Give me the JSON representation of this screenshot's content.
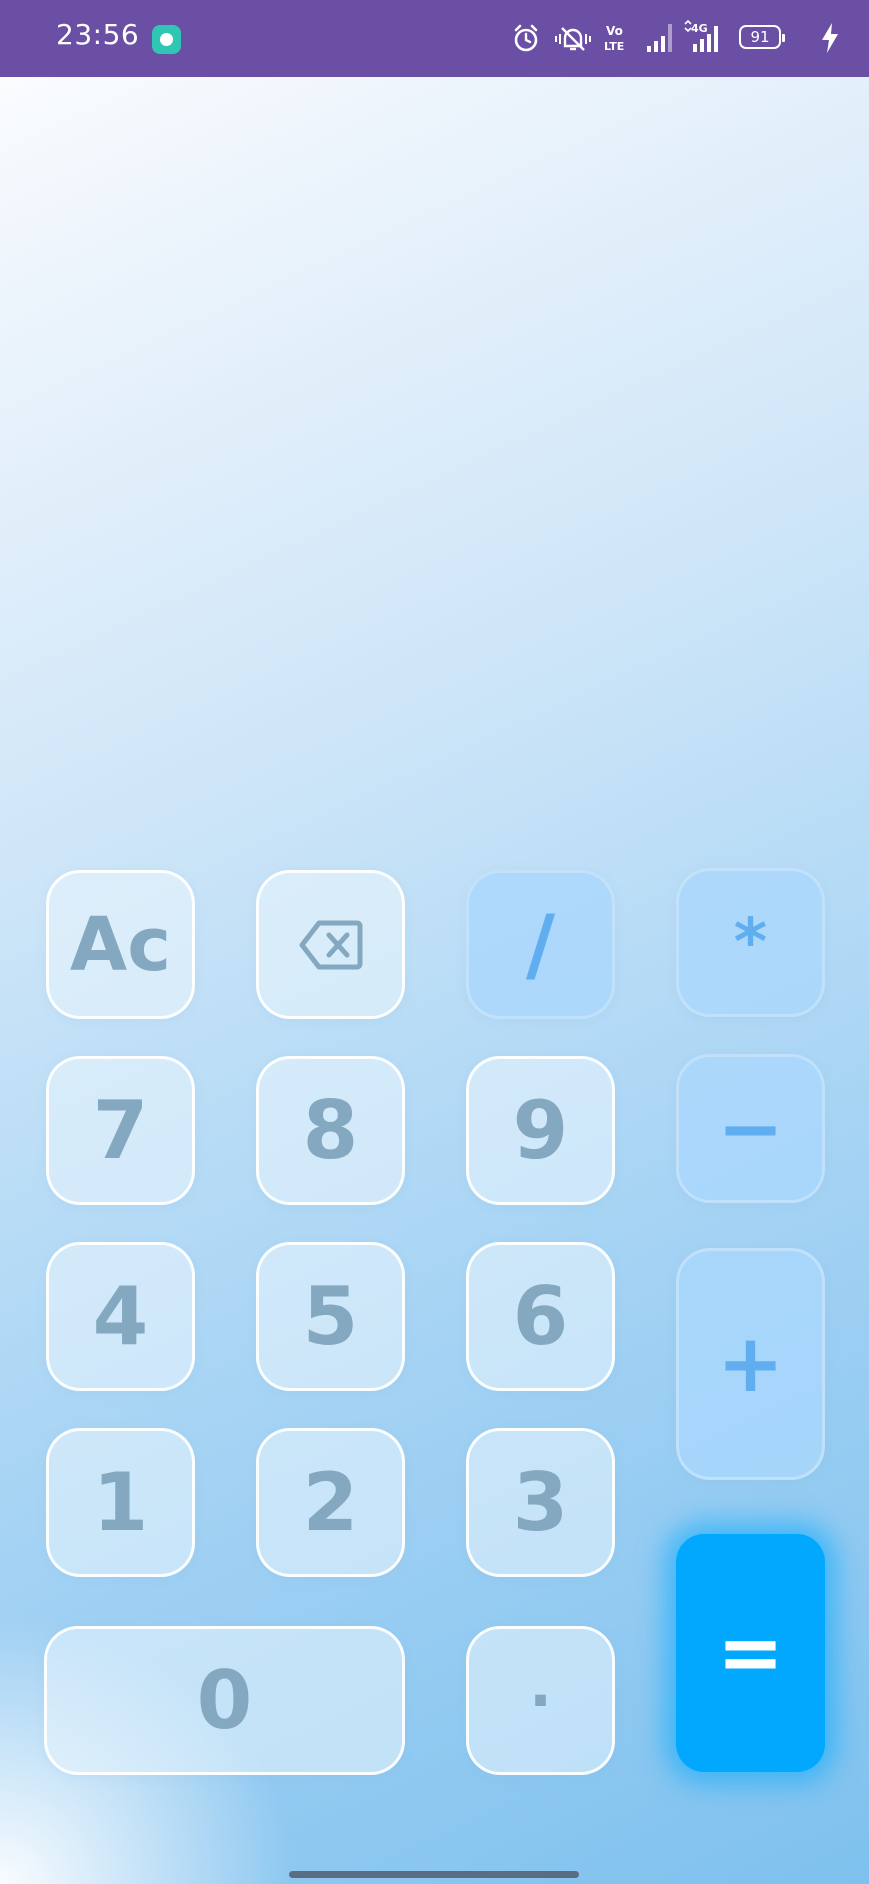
{
  "status_bar": {
    "time": "23:56",
    "battery": "91",
    "network": "4G",
    "volte_top": "Vo",
    "volte_bottom": "LTE",
    "icons": [
      "app-notification-icon",
      "alarm-icon",
      "vibrate-mute-icon",
      "volte-icon",
      "signal-icon",
      "signal-4g-icon",
      "battery-icon",
      "charging-icon"
    ]
  },
  "display": {
    "expression": "",
    "result": ""
  },
  "keys": {
    "clear": "Ac",
    "backspace_icon": "backspace-icon",
    "divide": "/",
    "multiply": "*",
    "seven": "7",
    "eight": "8",
    "nine": "9",
    "minus": "−",
    "four": "4",
    "five": "5",
    "six": "6",
    "plus": "+",
    "one": "1",
    "two": "2",
    "three": "3",
    "zero": "0",
    "dot": "·",
    "equals": "="
  },
  "colors": {
    "status_bar": "#6a4fa5",
    "key_text": "#83a8bf",
    "operator_text": "#60aef0",
    "equals_bg": "#02a8fd"
  }
}
